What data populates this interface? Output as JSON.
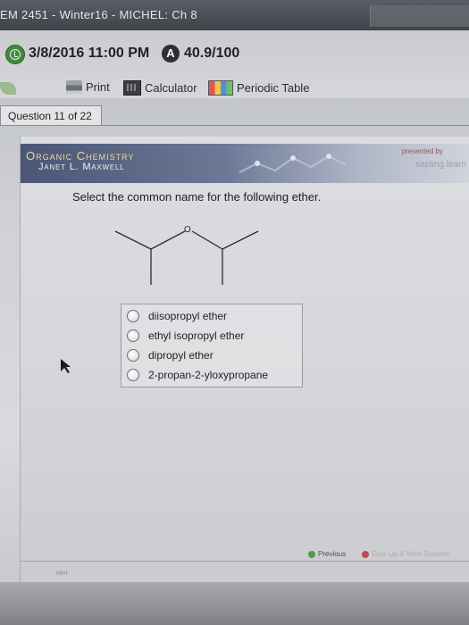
{
  "window": {
    "title": "EM 2451 - Winter16 - MICHEL: Ch 8"
  },
  "due": {
    "datetime": "3/8/2016 11:00 PM",
    "score_icon": "A",
    "score": "40.9/100"
  },
  "toolbar": {
    "print": "Print",
    "calculator": "Calculator",
    "periodic_table": "Periodic Table"
  },
  "question": {
    "tab": "Question 11 of 22",
    "prompt": "Select the common name for the following ether."
  },
  "banner": {
    "title": "Organic Chemistry",
    "author": "Janet L. Maxwell",
    "presented_by": "presented by",
    "brand": "sapling learn"
  },
  "molecule": {
    "atom_label": "O"
  },
  "choices": [
    {
      "label": "diisopropyl ether",
      "selected": false
    },
    {
      "label": "ethyl isopropyl ether",
      "selected": false
    },
    {
      "label": "dipropyl ether",
      "selected": false
    },
    {
      "label": "2-propan-2-yloxypropane",
      "selected": false
    }
  ],
  "nav": {
    "previous": "Previous",
    "give_up": "Give Up & View Solution",
    "hint": "Hint"
  },
  "colors": {
    "banner": "#4a5673",
    "accent_green": "#3e8a3c",
    "text": "#1e1f23"
  }
}
